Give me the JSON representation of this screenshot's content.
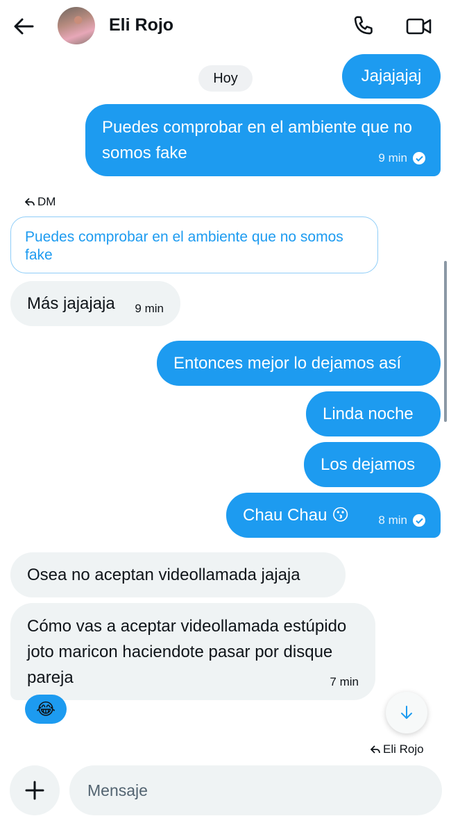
{
  "header": {
    "contact_name": "Eli Rojo",
    "icons": {
      "back": "arrow-left-icon",
      "call": "phone-icon",
      "video": "video-camera-icon"
    }
  },
  "day_divider": "Hoy",
  "messages": [
    {
      "id": "m1",
      "side": "out",
      "text": "Jajajajaj"
    },
    {
      "id": "m2",
      "side": "out",
      "text": "Puedes comprobar en el ambiente que no somos fake",
      "time": "9 min",
      "status": "read"
    },
    {
      "id": "m3",
      "side": "in",
      "reply_to_label": "DM",
      "quoted_text": "Puedes comprobar en el ambiente que no somos fake",
      "text": "Más jajajaja",
      "time": "9 min"
    },
    {
      "id": "m4",
      "side": "out",
      "text": "Entonces mejor lo dejamos así"
    },
    {
      "id": "m5",
      "side": "out",
      "text": "Linda noche"
    },
    {
      "id": "m6",
      "side": "out",
      "text": "Los dejamos"
    },
    {
      "id": "m7",
      "side": "out",
      "text": "Chau Chau 😗",
      "time": "8 min",
      "status": "read"
    },
    {
      "id": "m8",
      "side": "in",
      "text": "Osea no aceptan videollamada jajaja"
    },
    {
      "id": "m9",
      "side": "in",
      "text": "Cómo vas a aceptar videollamada estúpido joto maricon haciendote pasar por disque pareja",
      "time": "7 min",
      "reaction": "😂"
    }
  ],
  "reply_indicator": "Eli Rojo",
  "composer": {
    "placeholder": "Mensaje",
    "value": ""
  },
  "colors": {
    "accent": "#1d9bf0",
    "incoming_bg": "#eff3f4",
    "text": "#0f1419"
  }
}
